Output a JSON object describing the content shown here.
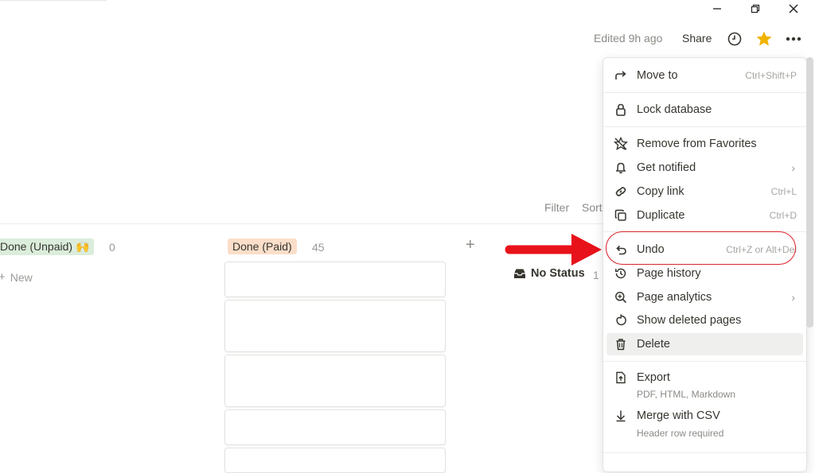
{
  "window": {
    "minimize_icon": "minimize-icon",
    "restore_icon": "restore-icon",
    "close_icon": "close-icon"
  },
  "topbar": {
    "edited": "Edited 9h ago",
    "share": "Share",
    "favorite_color": "#f0b400"
  },
  "view_controls": {
    "filter": "Filter",
    "sort": "Sort"
  },
  "board": {
    "columns": [
      {
        "name": "Done (Unpaid) 🙌",
        "count": "0",
        "bg": "#dbeddb",
        "new_label": "New"
      },
      {
        "name": "Done (Paid)",
        "count": "45",
        "bg": "#fadec9"
      },
      {
        "name": "No Status",
        "count": "1"
      }
    ]
  },
  "menu": {
    "items": [
      {
        "label": "Move to",
        "shortcut": "Ctrl+Shift+P"
      },
      {
        "label": "Lock database"
      },
      {
        "label": "Remove from Favorites"
      },
      {
        "label": "Get notified"
      },
      {
        "label": "Copy link",
        "shortcut": "Ctrl+L"
      },
      {
        "label": "Duplicate",
        "shortcut": "Ctrl+D"
      },
      {
        "label": "Undo",
        "shortcut": "Ctrl+Z or Alt+Del"
      },
      {
        "label": "Page history"
      },
      {
        "label": "Page analytics"
      },
      {
        "label": "Show deleted pages"
      },
      {
        "label": "Delete"
      },
      {
        "label": "Export",
        "sub": "PDF, HTML, Markdown"
      },
      {
        "label": "Merge with CSV",
        "sub": "Header row required"
      }
    ]
  },
  "annotation": {
    "arrow_color": "#e8121a",
    "circle_color": "#d9232d"
  }
}
